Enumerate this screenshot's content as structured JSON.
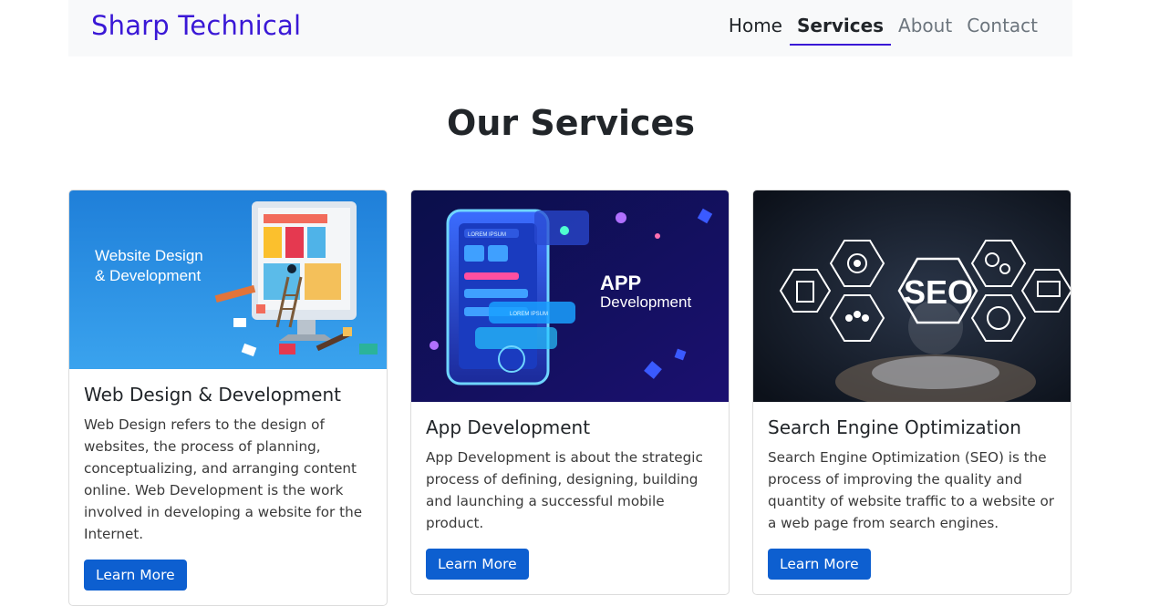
{
  "brand": "Sharp Technical",
  "nav": [
    {
      "label": "Home"
    },
    {
      "label": "Services"
    },
    {
      "label": "About"
    },
    {
      "label": "Contact"
    }
  ],
  "heading": "Our Services",
  "cards": [
    {
      "title": "Web Design & Development",
      "text": "Web Design refers to the design of websites, the process of planning, conceptualizing, and arranging content online. Web Development is the work involved in developing a website for the Internet.",
      "button": "Learn More",
      "image_text_1": "Website Design",
      "image_text_2": "& Development"
    },
    {
      "title": "App Development",
      "text": "App Development is about the strategic process of defining, designing, building and launching a successful mobile product.",
      "button": "Learn More",
      "image_text_1": "APP",
      "image_text_2": "Development",
      "image_small_1": "LOREM IPSUM",
      "image_small_2": "LOREM IPSUM"
    },
    {
      "title": "Search Engine Optimization",
      "text": "Search Engine Optimization (SEO) is the process of improving the quality and quantity of website traffic to a website or a web page from search engines.",
      "button": "Learn More",
      "image_text_1": "SEO"
    }
  ],
  "colors": {
    "brand": "#3a18d6",
    "button": "#0d5fd0",
    "navbar_bg": "#f8f9fa"
  }
}
